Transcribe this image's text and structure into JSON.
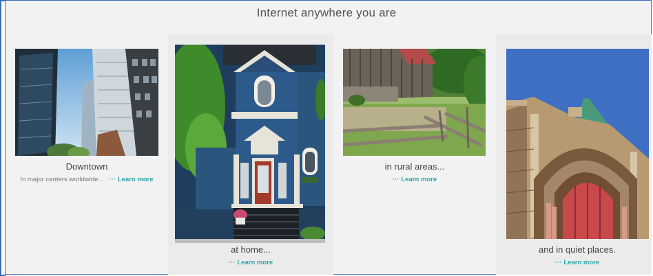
{
  "title": "Internet anywhere you are",
  "cards": [
    {
      "caption": "Downtown",
      "subtitle": "In major centers worldwide...",
      "dots": "···",
      "link": "Learn more",
      "image": "city-skyscrapers-photo"
    },
    {
      "caption": "at home...",
      "dots": "···",
      "link": "Learn more",
      "image": "blue-victorian-house-photo"
    },
    {
      "caption": "in rural areas...",
      "dots": "···",
      "link": "Learn more",
      "image": "barn-rural-field-photo"
    },
    {
      "caption": "and in quiet places.",
      "dots": "···",
      "link": "Learn more",
      "image": "stone-church-arch-photo"
    }
  ],
  "colors": {
    "background": "#f2f2f2",
    "card_raised": "#ebebeb",
    "link": "#2aa6a8",
    "frame": "#3a6fb5",
    "text": "#444444"
  }
}
